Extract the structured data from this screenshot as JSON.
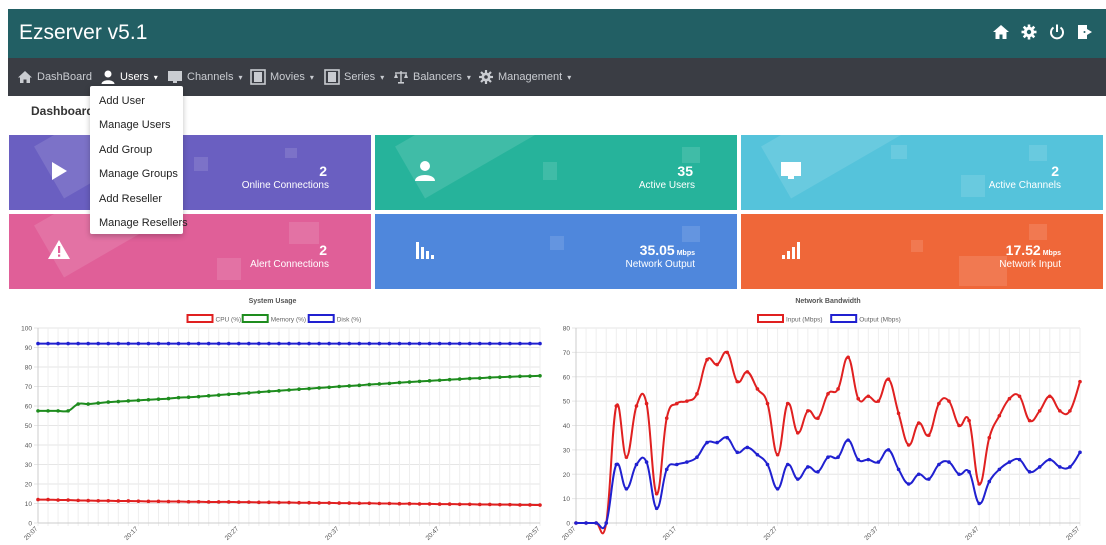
{
  "app": {
    "title": "Ezserver v5.1"
  },
  "header": {
    "icons": [
      "home-icon",
      "gear-icon",
      "power-icon",
      "logout-icon"
    ]
  },
  "nav": [
    {
      "label": "DashBoard",
      "icon": "home-icon",
      "caret": ""
    },
    {
      "label": "Users",
      "icon": "user-icon",
      "caret": "▾"
    },
    {
      "label": "Channels",
      "icon": "monitor-icon",
      "caret": "▾"
    },
    {
      "label": "Movies",
      "icon": "film-icon",
      "caret": "▾"
    },
    {
      "label": "Series",
      "icon": "film-icon",
      "caret": "▾"
    },
    {
      "label": "Balancers",
      "icon": "scales-icon",
      "caret": "▾"
    },
    {
      "label": "Management",
      "icon": "gear-icon",
      "caret": "▾"
    }
  ],
  "breadcrumb": "Dashboard",
  "users_menu": [
    "Add User",
    "Manage Users",
    "Add Group",
    "Manage Groups",
    "Add Reseller",
    "Manage Resellers"
  ],
  "tiles": [
    {
      "value": "2",
      "unit": "",
      "label": "Online Connections",
      "color": "#6a5fc1",
      "icon": "play-icon"
    },
    {
      "value": "35",
      "unit": "",
      "label": "Active Users",
      "color": "#26b39b",
      "icon": "user-icon"
    },
    {
      "value": "2",
      "unit": "",
      "label": "Active Channels",
      "color": "#55c3db",
      "icon": "monitor-icon"
    },
    {
      "value": "2",
      "unit": "",
      "label": "Alert Connections",
      "color": "#e05f98",
      "icon": "warning-icon"
    },
    {
      "value": "35.05",
      "unit": "Mbps",
      "label": "Network Output",
      "color": "#4f87dc",
      "icon": "bars-down-icon"
    },
    {
      "value": "17.52",
      "unit": "Mbps",
      "label": "Network Input",
      "color": "#ef6739",
      "icon": "bars-up-icon"
    }
  ],
  "chart_data": [
    {
      "type": "line",
      "title": "System Usage",
      "xlabel": "",
      "ylabel": "",
      "ylim": [
        0,
        100
      ],
      "yticks": [
        0,
        10,
        20,
        30,
        40,
        50,
        60,
        70,
        80,
        90,
        100
      ],
      "x": [
        "20:07",
        "20:08",
        "20:09",
        "20:10",
        "20:11",
        "20:12",
        "20:13",
        "20:14",
        "20:15",
        "20:16",
        "20:17",
        "20:18",
        "20:19",
        "20:20",
        "20:21",
        "20:22",
        "20:23",
        "20:24",
        "20:25",
        "20:26",
        "20:27",
        "20:28",
        "20:29",
        "20:30",
        "20:31",
        "20:32",
        "20:33",
        "20:34",
        "20:35",
        "20:36",
        "20:37",
        "20:38",
        "20:39",
        "20:40",
        "20:41",
        "20:42",
        "20:43",
        "20:44",
        "20:45",
        "20:46",
        "20:47",
        "20:48",
        "20:49",
        "20:50",
        "20:51",
        "20:52",
        "20:53",
        "20:54",
        "20:55",
        "20:56",
        "20:57"
      ],
      "xtick_labels": [
        "20:07",
        "20:17",
        "20:27",
        "20:37",
        "20:47",
        "20:57"
      ],
      "grid": true,
      "legend": "top",
      "series": [
        {
          "name": "CPU (%)",
          "color": "#e02020",
          "values": [
            12,
            12,
            11.8,
            11.8,
            11.6,
            11.5,
            11.4,
            11.4,
            11.3,
            11.3,
            11.2,
            11.1,
            11.1,
            11.0,
            11.0,
            10.9,
            10.9,
            10.8,
            10.8,
            10.8,
            10.7,
            10.7,
            10.6,
            10.6,
            10.5,
            10.5,
            10.4,
            10.4,
            10.3,
            10.3,
            10.2,
            10.2,
            10.1,
            10.1,
            10.0,
            10.0,
            9.9,
            9.9,
            9.8,
            9.8,
            9.7,
            9.7,
            9.6,
            9.6,
            9.5,
            9.5,
            9.4,
            9.4,
            9.3,
            9.3,
            9.2
          ]
        },
        {
          "name": "Memory (%)",
          "color": "#1e8c1e",
          "values": [
            57.5,
            57.5,
            57.5,
            57.5,
            61,
            61,
            61.5,
            62,
            62.3,
            62.6,
            62.9,
            63.2,
            63.5,
            63.8,
            64.3,
            64.5,
            64.8,
            65.2,
            65.6,
            66,
            66.3,
            66.7,
            67.1,
            67.5,
            67.8,
            68.2,
            68.6,
            68.9,
            69.3,
            69.6,
            70,
            70.3,
            70.6,
            71,
            71.3,
            71.6,
            72,
            72.3,
            72.6,
            72.9,
            73.2,
            73.5,
            73.8,
            74.1,
            74.3,
            74.6,
            74.8,
            75,
            75.2,
            75.3,
            75.5
          ]
        },
        {
          "name": "Disk (%)",
          "color": "#2020d0",
          "values": [
            92,
            92,
            92,
            92,
            92,
            92,
            92,
            92,
            92,
            92,
            92,
            92,
            92,
            92,
            92,
            92,
            92,
            92,
            92,
            92,
            92,
            92,
            92,
            92,
            92,
            92,
            92,
            92,
            92,
            92,
            92,
            92,
            92,
            92,
            92,
            92,
            92,
            92,
            92,
            92,
            92,
            92,
            92,
            92,
            92,
            92,
            92,
            92,
            92,
            92,
            92
          ]
        }
      ]
    },
    {
      "type": "line",
      "title": "Network Bandwidth",
      "xlabel": "",
      "ylabel": "",
      "ylim": [
        0,
        80
      ],
      "yticks": [
        0,
        10,
        20,
        30,
        40,
        50,
        60,
        70,
        80
      ],
      "x": [
        "20:07",
        "20:08",
        "20:09",
        "20:10",
        "20:11",
        "20:12",
        "20:13",
        "20:14",
        "20:15",
        "20:16",
        "20:17",
        "20:18",
        "20:19",
        "20:20",
        "20:21",
        "20:22",
        "20:23",
        "20:24",
        "20:25",
        "20:26",
        "20:27",
        "20:28",
        "20:29",
        "20:30",
        "20:31",
        "20:32",
        "20:33",
        "20:34",
        "20:35",
        "20:36",
        "20:37",
        "20:38",
        "20:39",
        "20:40",
        "20:41",
        "20:42",
        "20:43",
        "20:44",
        "20:45",
        "20:46",
        "20:47",
        "20:48",
        "20:49",
        "20:50",
        "20:51",
        "20:52",
        "20:53",
        "20:54",
        "20:55",
        "20:56",
        "20:57"
      ],
      "xtick_labels": [
        "20:07",
        "20:17",
        "20:27",
        "20:37",
        "20:47",
        "20:57"
      ],
      "grid": true,
      "legend": "top",
      "series": [
        {
          "name": "Input (Mbps)",
          "color": "#e02020",
          "values": [
            0,
            0,
            0,
            0,
            48,
            27,
            48,
            49,
            12,
            43,
            49,
            50,
            53,
            67,
            65,
            70,
            58,
            62,
            55,
            49,
            28,
            49,
            37,
            46,
            43,
            53,
            55,
            68,
            51,
            52,
            50,
            59,
            45,
            32,
            41,
            36,
            49,
            50,
            40,
            42,
            16,
            35,
            44,
            51,
            52,
            42,
            46,
            52,
            46,
            46,
            58
          ]
        },
        {
          "name": "Output (Mbps)",
          "color": "#2020d0",
          "values": [
            0,
            0,
            0,
            0,
            24,
            14,
            24,
            25,
            6,
            22,
            24,
            25,
            27,
            33,
            33,
            35,
            29,
            31,
            28,
            24,
            14,
            24,
            18,
            23,
            21,
            27,
            27,
            34,
            26,
            26,
            25,
            30,
            22,
            16,
            20,
            18,
            24,
            25,
            20,
            21,
            8,
            17,
            22,
            25,
            26,
            21,
            23,
            26,
            23,
            23,
            29
          ]
        }
      ]
    }
  ]
}
